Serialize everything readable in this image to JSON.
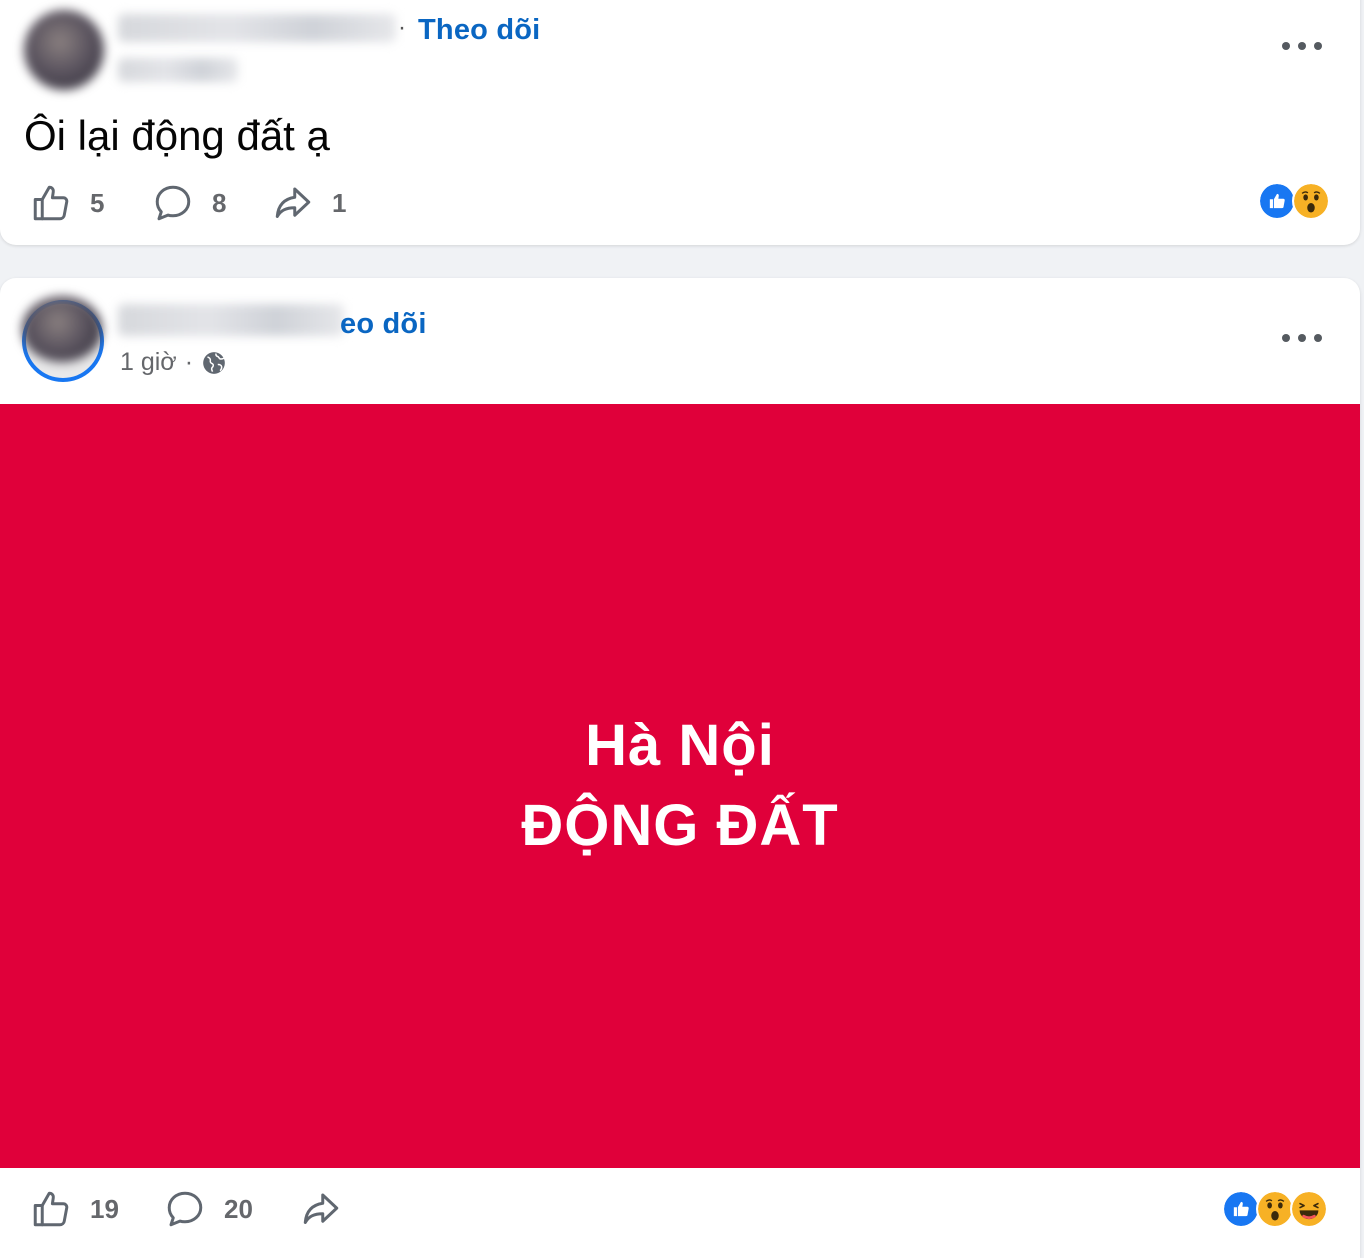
{
  "colors": {
    "follow_blue": "#0a66c2",
    "banner_red": "#e0003a",
    "like_blue": "#1877f2",
    "wow_yellow": "#f7b125"
  },
  "post1": {
    "follow_label": "Theo dõi",
    "separator": "·",
    "text": "Ôi lại động đất ạ",
    "likes": "5",
    "comments": "8",
    "shares": "1",
    "reactions": [
      "like-reaction-icon",
      "wow-reaction-icon"
    ]
  },
  "post2": {
    "follow_label": "eo dõi",
    "time": "1 giờ",
    "separator": "·",
    "banner_title": "Hà Nội",
    "banner_subtitle": "ĐỘNG ĐẤT",
    "likes": "19",
    "comments": "20",
    "shares": "",
    "reactions": [
      "like-reaction-icon",
      "wow-reaction-icon",
      "haha-reaction-icon"
    ]
  }
}
